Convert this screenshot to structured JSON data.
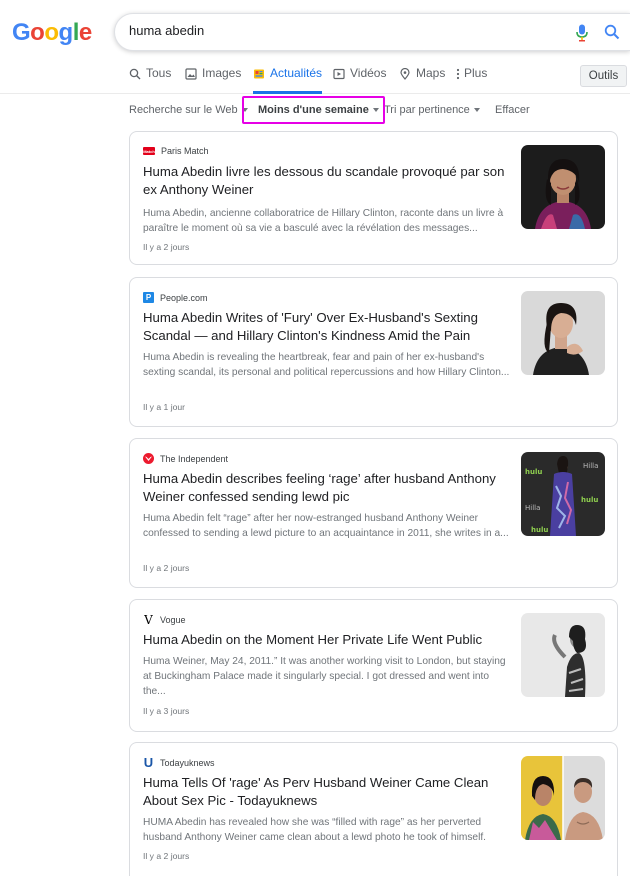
{
  "logo": {
    "letters": [
      "G",
      "o",
      "o",
      "g",
      "l",
      "e"
    ]
  },
  "search": {
    "query": "huma abedin"
  },
  "tabs": [
    {
      "label": "Tous",
      "icon": "search-icon"
    },
    {
      "label": "Images",
      "icon": "image-icon"
    },
    {
      "label": "Actualités",
      "icon": "news-icon",
      "active": true
    },
    {
      "label": "Vidéos",
      "icon": "video-icon"
    },
    {
      "label": "Maps",
      "icon": "map-pin-icon"
    },
    {
      "label": "Plus",
      "icon": "more-vert-icon"
    }
  ],
  "tools_label": "Outils",
  "filters": {
    "web": "Recherche sur le Web",
    "time": "Moins d'une semaine",
    "sort": "Tri par pertinence",
    "clear": "Effacer"
  },
  "colors": {
    "google_blue": "#4285f4",
    "google_red": "#ea4335",
    "google_yellow": "#fbbc05",
    "google_green": "#34a853",
    "active_tab": "#1a73e8",
    "highlight": "#e600e6"
  },
  "results": [
    {
      "source": "Paris Match",
      "favicon_text": "Match",
      "favicon_color": "#e2001a",
      "title": "Huma Abedin livre les dessous du scandale provoqué par son ex Anthony Weiner",
      "snippet": "Huma Abedin, ancienne collaboratrice de Hillary Clinton, raconte dans un livre à paraître le moment où sa vie a basculé avec la révélation des messages...",
      "date": "Il y a 2 jours"
    },
    {
      "source": "People.com",
      "favicon_text": "P",
      "favicon_color": "#1e88e5",
      "title": "Huma Abedin Writes of 'Fury' Over Ex-Husband's Sexting Scandal — and Hillary Clinton's Kindness Amid the Pain",
      "snippet": "Huma Abedin is revealing the heartbreak, fear and pain of her ex-husband's sexting scandal, its personal and political repercussions and how Hillary Clinton...",
      "date": "Il y a 1 jour"
    },
    {
      "source": "The Independent",
      "favicon_text": "",
      "favicon_color": "#ec1a2e",
      "title": "Huma Abedin describes feeling ‘rage’ after husband Anthony Weiner confessed sending lewd pic",
      "snippet": "Huma Abedin felt “rage” after her now-estranged husband Anthony Weiner confessed to sending a lewd picture to an acquaintance in 2011, she writes in a...",
      "date": "Il y a 2 jours"
    },
    {
      "source": "Vogue",
      "favicon_text": "V",
      "favicon_color": "#000000",
      "title": "Huma Abedin on the Moment Her Private Life Went Public",
      "snippet": "Huma Weiner, May 24, 2011.” It was another working visit to London, but staying at Buckingham Palace made it singularly special. I got dressed and went into the...",
      "date": "Il y a 3 jours"
    },
    {
      "source": "Todayuknews",
      "favicon_text": "U",
      "favicon_color": "#1a56a8",
      "title": "Huma Tells Of 'rage' As Perv Husband Weiner Came Clean About Sex Pic - Todayuknews",
      "snippet": "HUMA Abedin has revealed how she was “filled with rage” as her perverted husband Anthony Weiner came clean about a lewd photo he took of himself.",
      "date": "Il y a 2 jours"
    }
  ]
}
